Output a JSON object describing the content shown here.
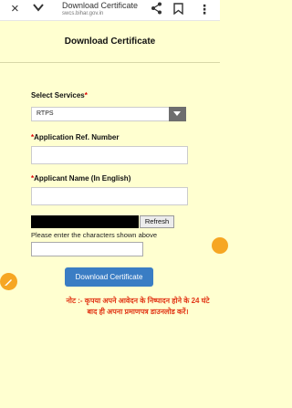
{
  "browser": {
    "title": "Download Certificate",
    "url": "swcs.bihar.gov.in",
    "close_icon": "×",
    "more_icon": "⋮"
  },
  "page": {
    "heading": "Download Certificate"
  },
  "form": {
    "services_label": "Select Services",
    "services_value": "RTPS",
    "required_mark": "*",
    "app_ref_label": "Application Ref. Number",
    "applicant_name_label": "Applicant Name (In English)",
    "refresh_label": "Refresh",
    "captcha_hint": "Please enter the characters shown above",
    "download_button": "Download Certificate"
  },
  "note": "नोट :- कृपया अपने आवेदन के निष्पादन होने के 24 घंटे बाद ही अपना प्रमाणपत्र डाउनलोड करें।",
  "colors": {
    "background": "#ffffd0",
    "button": "#3a7dc4",
    "note": "#e23a1a",
    "fab": "#f6a623"
  }
}
